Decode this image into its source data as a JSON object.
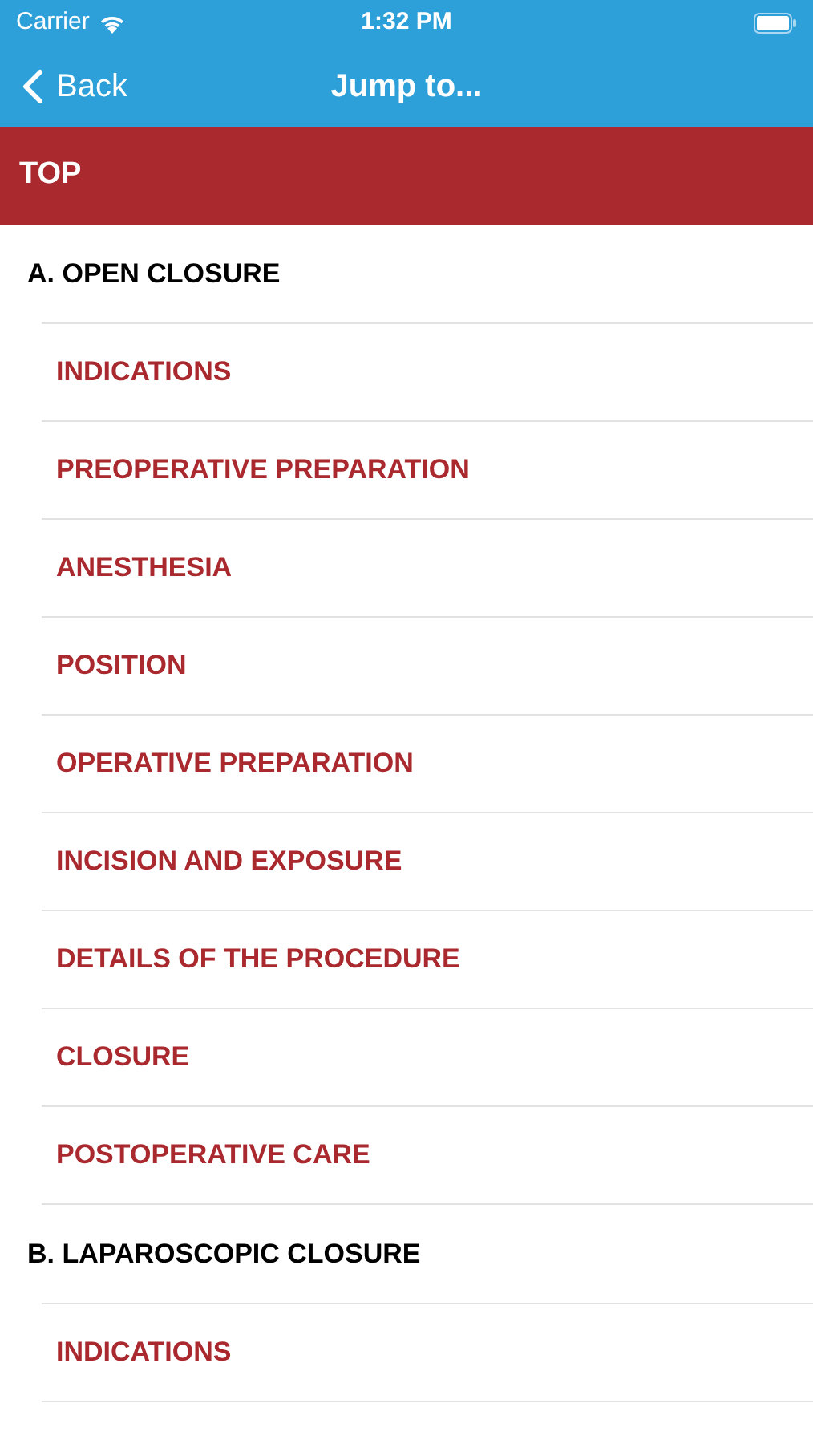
{
  "status_bar": {
    "carrier": "Carrier",
    "time": "1:32 PM"
  },
  "nav": {
    "back": "Back",
    "title": "Jump to..."
  },
  "top": {
    "label": "TOP"
  },
  "sections": [
    {
      "title": "A. OPEN CLOSURE",
      "items": [
        {
          "label": "INDICATIONS"
        },
        {
          "label": "PREOPERATIVE PREPARATION"
        },
        {
          "label": "ANESTHESIA"
        },
        {
          "label": "POSITION"
        },
        {
          "label": "OPERATIVE PREPARATION"
        },
        {
          "label": "INCISION AND EXPOSURE"
        },
        {
          "label": "DETAILS OF THE PROCEDURE"
        },
        {
          "label": "CLOSURE"
        },
        {
          "label": "POSTOPERATIVE CARE"
        }
      ]
    },
    {
      "title": "B. LAPAROSCOPIC CLOSURE",
      "items": [
        {
          "label": "INDICATIONS"
        }
      ]
    }
  ]
}
